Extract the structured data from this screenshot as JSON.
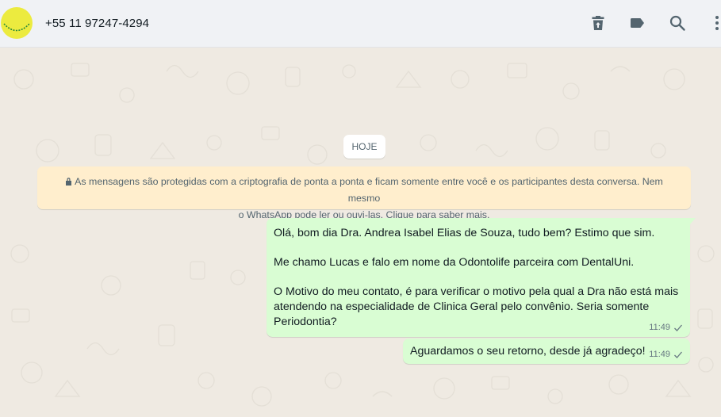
{
  "header": {
    "contact_name": "+55 11 97247-4294",
    "icons": [
      "delete-icon",
      "label-icon",
      "search-icon",
      "menu-icon"
    ]
  },
  "chat": {
    "date_label": "HOJE",
    "encryption_notice": {
      "line1": "As mensagens são protegidas com a criptografia de ponta a ponta e ficam somente entre você e os participantes desta conversa. Nem mesmo",
      "line2": "o WhatsApp pode ler ou ouvi-las. Clique para saber mais."
    },
    "messages": [
      {
        "paragraphs": [
          "Olá, bom dia Dra. Andrea Isabel Elias de Souza, tudo bem? Estimo que sim.",
          "Me chamo Lucas e falo em nome da Odontolife parceira com DentalUni.",
          "O Motivo do meu contato, é para verificar o motivo pela qual a Dra não está mais atendendo na especialidade de Clinica Geral pelo convênio. Seria somente Periodontia?"
        ],
        "time": "11:49",
        "status": "sent"
      },
      {
        "text": "Aguardamos o seu retorno, desde já agradeço!",
        "time": "11:49",
        "status": "sent"
      }
    ]
  },
  "colors": {
    "header_bg": "#f0f2f5",
    "chat_bg": "#efeae2",
    "outgoing_bubble": "#d9fdd3",
    "notice_bg": "#ffeecd",
    "avatar": "#eceb3f",
    "icon": "#54656f"
  }
}
